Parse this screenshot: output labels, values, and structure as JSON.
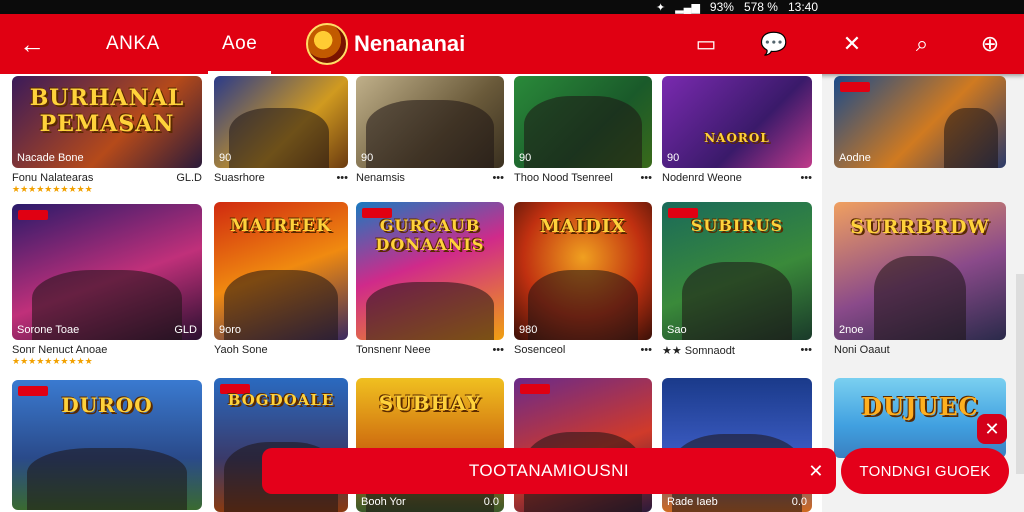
{
  "status": {
    "signal": "93%",
    "battery": "578 %",
    "time": "13:40"
  },
  "app_bar": {
    "back_icon": "arrow-left-icon",
    "tab1": "ANKA",
    "tab2": "Aoe",
    "brand_name": "Nenananai",
    "actions": [
      "bookmark-icon",
      "chat-icon",
      "tools-icon",
      "search-icon",
      "zoom-icon"
    ]
  },
  "columns": {
    "col1": [
      {
        "art": "BURHANAL PEMASAN",
        "over_left": "Nacade Bone",
        "title": "Fonu Nalatearas",
        "right": "GL.D",
        "stars": "★★★★★★★★★★"
      },
      {
        "art": "",
        "over_left": "Sorone Toae",
        "over_right": "GLD",
        "title": "Sonr Nenuct Anoae",
        "stars": "★★★★★★★★★★"
      },
      {
        "art": "DUROO",
        "title": ""
      }
    ],
    "col2": [
      {
        "art": "",
        "over_left": "90",
        "title": "Suasrhore",
        "right": "•••"
      },
      {
        "art": "MAIREEK",
        "over_left": "9oro",
        "title": "Yaoh Sone",
        "right": ""
      },
      {
        "art": "BOGDOALE",
        "title": ""
      }
    ],
    "col3": [
      {
        "art": "",
        "over_left": "90",
        "title": "Nenamsis",
        "right": "•••"
      },
      {
        "art": "GURCAUB DONAANIS",
        "title": "Tonsnenr Neee",
        "right": "•••"
      },
      {
        "art": "SUBHAY",
        "over_left": "Booh Yor",
        "over_right": "0.0",
        "title": ""
      }
    ],
    "col4": [
      {
        "art": "",
        "over_left": "90",
        "title": "Thoo Nood Tsenreel",
        "right": "•••"
      },
      {
        "art": "MAIDIX",
        "over_left": "980",
        "title": "Sosenceol",
        "right": "•••"
      },
      {
        "art": "",
        "title": ""
      }
    ],
    "col5": [
      {
        "art": "NAOROL",
        "over_left": "90",
        "title": "Nodenrd Weone",
        "right": "•••"
      },
      {
        "art": "SUBIRUS",
        "over_left": "Sao",
        "title": "★★ Somnaodt",
        "right": "•••"
      },
      {
        "art": "",
        "over_left": "Rade Iaeb",
        "over_right": "0.0",
        "title": ""
      }
    ],
    "col6": [
      {
        "art": "",
        "over_left": "Aodne",
        "title": "",
        "right": ""
      },
      {
        "art": "SURRBRDW",
        "over_left": "2noe",
        "title": "Noni Oaaut",
        "right": ""
      },
      {
        "art": "DUJUEC",
        "title": ""
      }
    ]
  },
  "bottom_bar": {
    "label": "TOOTANAMIOUSNI",
    "close_icon": "close-icon"
  },
  "pill_button": {
    "label": "TONDNGI GUOEK"
  },
  "colors": {
    "primary": "#e00012",
    "accent": "#ffd23b"
  }
}
